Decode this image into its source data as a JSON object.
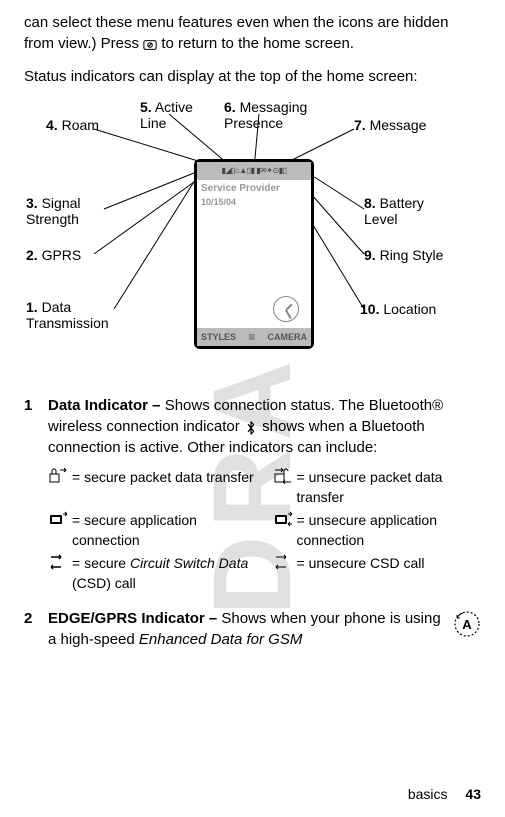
{
  "watermark": "DRAFT",
  "intro_para1": "can select these menu features even when the icons are hidden from view.) Press ",
  "intro_para1b": " to return to the home screen.",
  "intro_para2": "Status indicators can display at the top of the home screen:",
  "phone": {
    "status_bar": "▮◢▯⌂▲▯▮ ▮✉✦⊙▮▯",
    "provider": "Service Provider",
    "date": "10/15/04",
    "soft_left": "STYLES",
    "soft_mid": "≡",
    "soft_right": "CAMERA"
  },
  "callouts": {
    "c1": {
      "num": "1.",
      "text": "Data Transmission"
    },
    "c2": {
      "num": "2.",
      "text": "GPRS"
    },
    "c3": {
      "num": "3.",
      "text": "Signal Strength"
    },
    "c4": {
      "num": "4.",
      "text": "Roam"
    },
    "c5": {
      "num": "5.",
      "text": "Active Line"
    },
    "c6": {
      "num": "6.",
      "text": "Messaging Presence"
    },
    "c7": {
      "num": "7.",
      "text": "Message"
    },
    "c8": {
      "num": "8.",
      "text": "Battery Level"
    },
    "c9": {
      "num": "9.",
      "text": "Ring Style"
    },
    "c10": {
      "num": "10.",
      "text": "Location"
    }
  },
  "item1": {
    "num": "1",
    "title": "Data Indicator – ",
    "body1": "Shows connection status. The Bluetooth® wireless connection indicator ",
    "body2": " shows when a Bluetooth connection is active. Other indicators can include:"
  },
  "indicators": {
    "a": " = secure packet data transfer",
    "b": " = unsecure packet data transfer",
    "c": " = secure application connection",
    "d": " = unsecure application connection",
    "e_pre": " = secure ",
    "e_italic": "Circuit Switch Data",
    "e_post": " (CSD) call",
    "f": " = unsecure CSD call"
  },
  "item2": {
    "num": "2",
    "title": "EDGE/GPRS Indicator – ",
    "body": "Shows when your phone is using a high-speed ",
    "body_italic": "Enhanced Data for GSM"
  },
  "footer_label": "basics",
  "footer_page": "43"
}
